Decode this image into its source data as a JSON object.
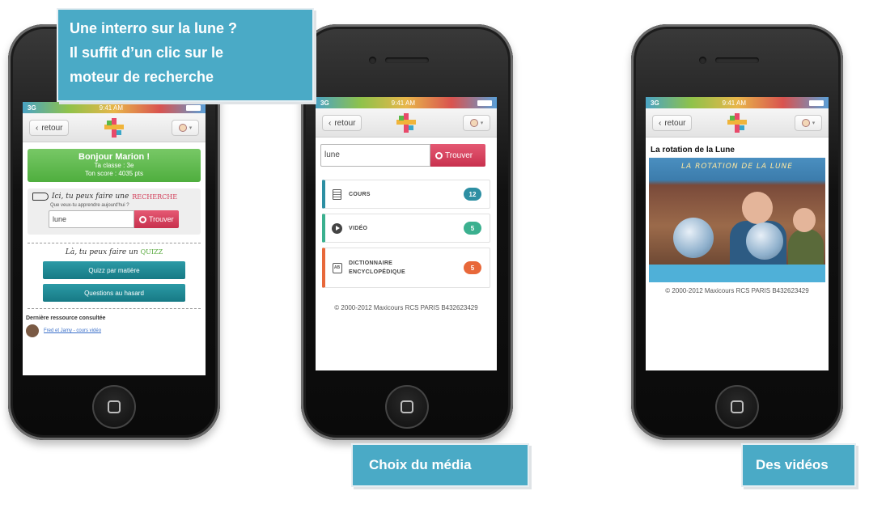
{
  "captions": {
    "search_line1": "Une interro  sur la lune ?",
    "search_line2": "Il suffit d’un clic sur le",
    "search_line3": "moteur de recherche",
    "media": "Choix du média",
    "videos": "Des vidéos"
  },
  "status": {
    "signal": "3G",
    "time": "9:41 AM"
  },
  "nav": {
    "back_label": "retour",
    "back_icon": "chevron-left-icon",
    "avatar_icon": "avatar-icon"
  },
  "phone1": {
    "greeting": "Bonjour Marion !",
    "class_line": "Ta classe : 3e",
    "score_line": "Ton score : 4035 pts",
    "search_prompt": "Ici, tu peux faire une",
    "search_word": "RECHERCHE",
    "search_question": "Que veux-tu apprendre aujourd'hui ?",
    "search_value": "lune",
    "find_label": "Trouver",
    "quiz_prompt": "Là, tu peux faire un",
    "quiz_word": "QUIZZ",
    "quiz_by_subject": "Quizz par matière",
    "quiz_random": "Questions au hasard",
    "last_resource_title": "Dernière ressource consultée",
    "last_resource_link": "Fred et Jamy - cours vidéo"
  },
  "phone2": {
    "search_value": "lune",
    "find_label": "Trouver",
    "results": [
      {
        "label": "COURS",
        "count": "12",
        "color": "#2d8fa3",
        "icon": "document-icon"
      },
      {
        "label": "VIDÉO",
        "count": "5",
        "color": "#3bb08f",
        "icon": "play-icon"
      },
      {
        "label": "DICTIONNAIRE",
        "label2": "ENCYCLOPÉDIQUE",
        "count": "5",
        "color": "#e8683a",
        "icon": "dictionary-icon"
      }
    ],
    "copyright": "© 2000-2012 Maxicours RCS PARIS B432623429"
  },
  "phone3": {
    "title": "La rotation de la Lune",
    "video_title": "LA ROTATION DE LA LUNE",
    "copyright": "© 2000-2012 Maxicours RCS PARIS B432623429"
  },
  "colors": {
    "caption": "#4aaac6",
    "find": "#d23a56",
    "teal": "#1f8a95",
    "green": "#5ab848"
  }
}
